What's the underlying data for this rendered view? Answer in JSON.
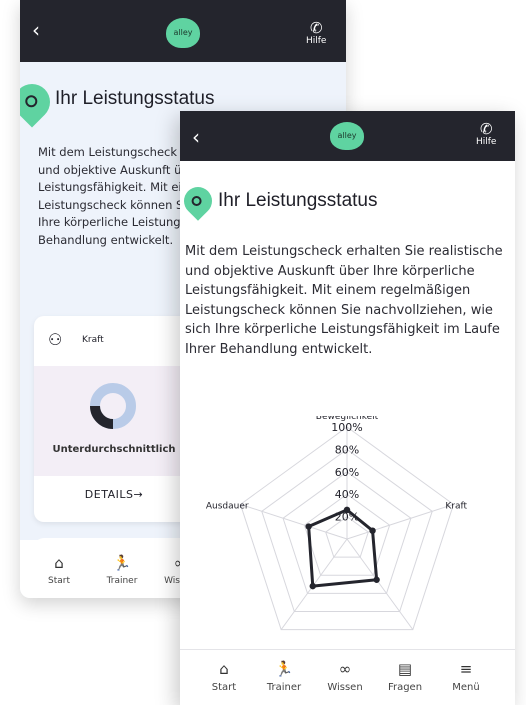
{
  "back_screen": {
    "header": {
      "back_icon": "‹",
      "logo": "alley",
      "help_label": "Hilfe"
    },
    "title": "Ihr Leistungsstatus",
    "description": "Mit dem Leistungscheck erhalten Sie realistische und objektive Auskunft über Ihre körperliche Leistungsfähigkeit. Mit einem regelmäßigen Leistungscheck können Sie nachvollziehen, wie sich Ihre körperliche Leistungsfähigkeit im Laufe Ihrer Behandlung entwickelt.",
    "card": {
      "label": "Kraft",
      "rating": "Unterdurchschnittlich",
      "details": "DETAILS→",
      "level": 0.25
    },
    "nav": [
      {
        "label": "Start",
        "icon": "home-icon"
      },
      {
        "label": "Trainer",
        "icon": "runner-icon"
      },
      {
        "label": "Wissen",
        "icon": "glasses-icon"
      }
    ]
  },
  "front_screen": {
    "header": {
      "back_icon": "‹",
      "logo": "alley",
      "help_label": "Hilfe"
    },
    "title": "Ihr Leistungsstatus",
    "description": "Mit dem Leistungscheck erhalten Sie realistische und objektive Auskunft über Ihre körperliche Leistungsfähigkeit. Mit einem regelmäßigen Leistungscheck können Sie nachvollziehen, wie sich Ihre körperliche Leistungsfähigkeit im Laufe Ihrer Behandlung entwickelt.",
    "nav": [
      {
        "label": "Start",
        "icon": "home-icon"
      },
      {
        "label": "Trainer",
        "icon": "runner-icon"
      },
      {
        "label": "Wissen",
        "icon": "glasses-icon"
      },
      {
        "label": "Fragen",
        "icon": "clipboard-icon"
      },
      {
        "label": "Menü",
        "icon": "menu-icon"
      }
    ]
  },
  "chart_data": {
    "type": "radar",
    "axes": [
      "Beweglichkeit",
      "Kraft",
      "",
      "",
      "Ausdauer"
    ],
    "tick_labels": [
      "20%",
      "40%",
      "60%",
      "80%",
      "100%"
    ],
    "series": [
      {
        "values": [
          0.26,
          0.24,
          0.45,
          0.52,
          0.36
        ]
      }
    ],
    "range": [
      0,
      1
    ],
    "colors": {
      "line": "#24252d",
      "grid": "#d7d7dd"
    }
  },
  "colors": {
    "brand": "#5fd3a1",
    "header": "#24252d",
    "accent_bg": "#eef3fb"
  }
}
